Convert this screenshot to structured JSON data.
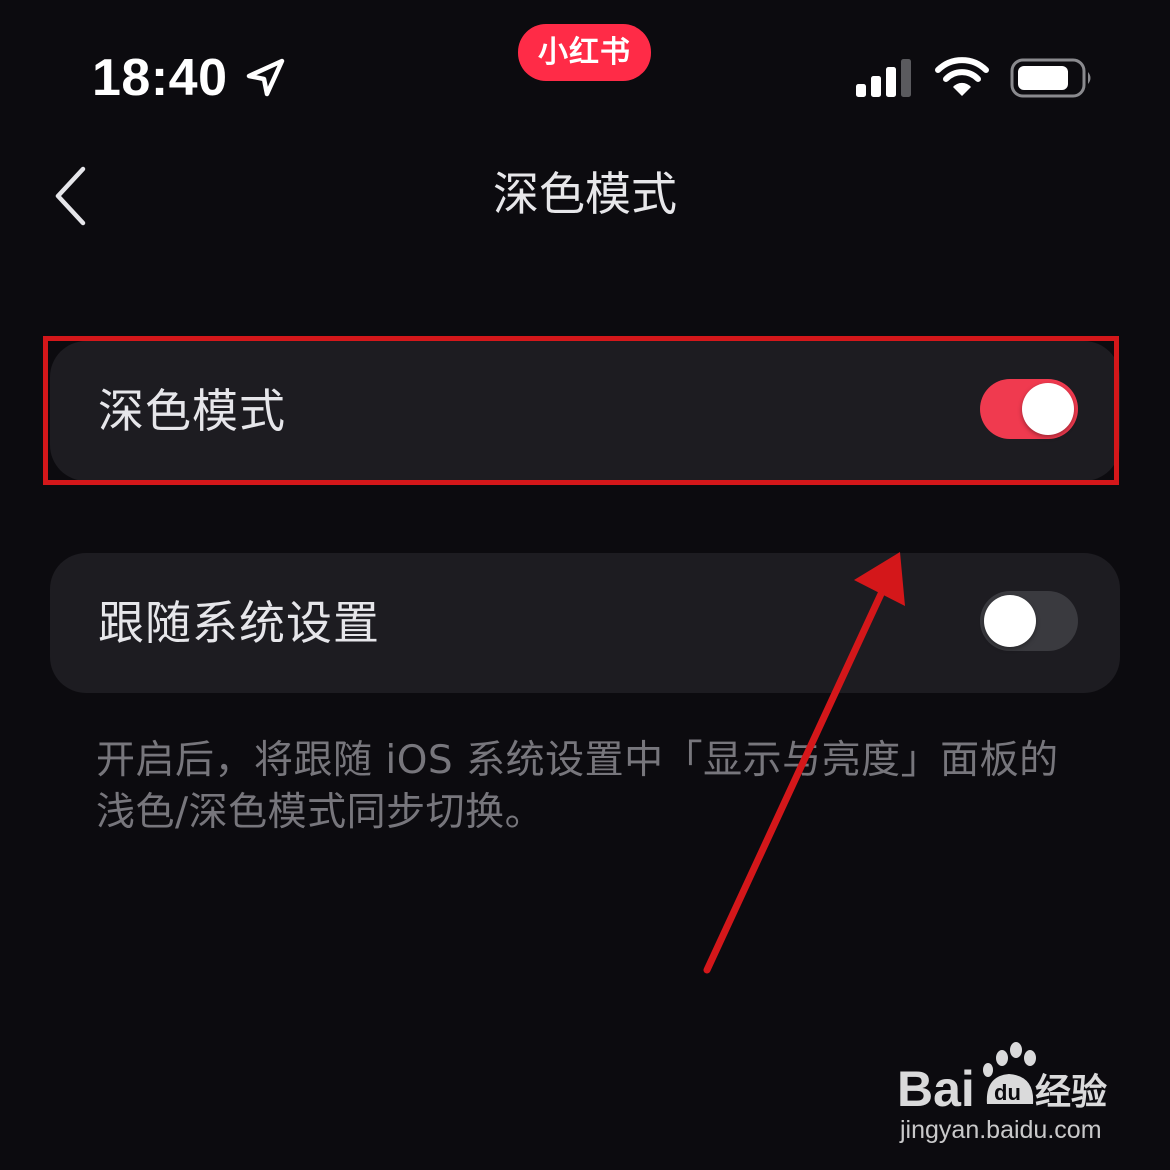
{
  "status_bar": {
    "time": "18:40",
    "location_icon": "location-arrow-icon",
    "app_badge": "小红书",
    "signal_icon": "cellular-signal-icon",
    "wifi_icon": "wifi-icon",
    "battery_icon": "battery-icon"
  },
  "nav": {
    "back_icon": "chevron-left-icon",
    "title": "深色模式"
  },
  "settings": [
    {
      "label": "深色模式",
      "enabled": true
    },
    {
      "label": "跟随系统设置",
      "enabled": false
    }
  ],
  "helper_text": "开启后，将跟随 iOS 系统设置中「显示与亮度」面板的浅色/深色模式同步切换。",
  "colors": {
    "background": "#0c0b0f",
    "card": "#1d1c21",
    "toggle_on": "#f03a4f",
    "toggle_off": "#3a3a3f",
    "annotation": "#d4171a",
    "brand": "#ff2b47"
  },
  "watermark": {
    "logo_text": "Bai du 经验",
    "url": "jingyan.baidu.com"
  }
}
